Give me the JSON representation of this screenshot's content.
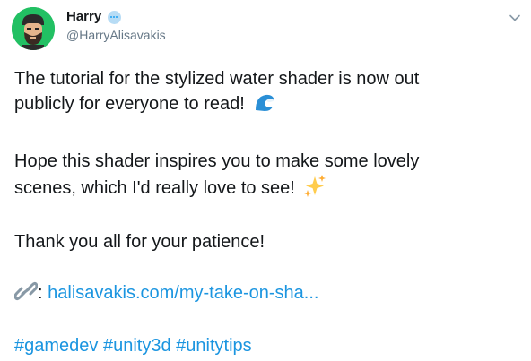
{
  "author": {
    "name": "Harry",
    "handle": "@HarryAlisavakis",
    "avatar_icon": "bearded-man-avatar",
    "avatar_bg": "#22c063",
    "badge_icon": "ellipsis-badge-icon"
  },
  "menu": {
    "icon": "chevron-down-icon"
  },
  "tweet": {
    "line1": "The tutorial for the stylized water shader is now out",
    "line2": "publicly for everyone to read!",
    "line2_emoji": "wave-emoji",
    "line3": "Hope this shader inspires you to make some lovely",
    "line4": "scenes, which I'd really love to see!",
    "line4_emoji": "sparkles-emoji",
    "line5": "Thank you all for your patience!",
    "link_prefix": ": ",
    "link_icon": "link-emoji",
    "link_text": "halisavakis.com/my-take-on-sha...",
    "hashtags": [
      "#gamedev",
      "#unity3d",
      "#unitytips"
    ]
  },
  "colors": {
    "text": "#14171a",
    "secondary": "#657786",
    "link": "#1b95e0"
  }
}
